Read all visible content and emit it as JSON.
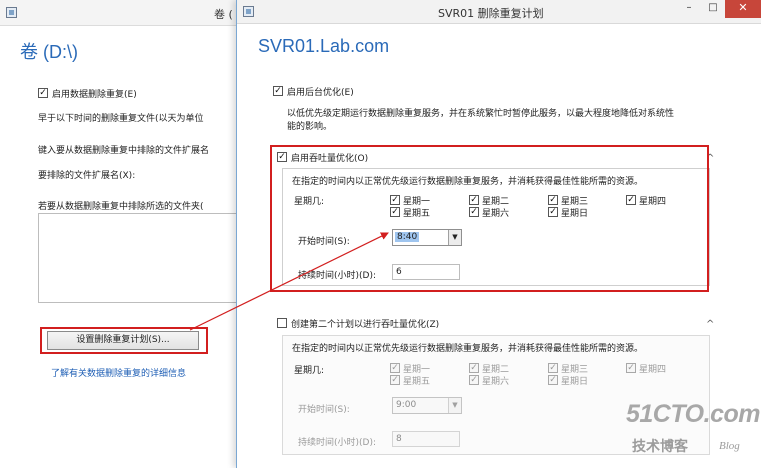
{
  "back_window": {
    "title": "卷 (",
    "heading": "卷 (D:\\)",
    "enable_dedup": {
      "label": "启用数据删除重复(E)",
      "checked": true
    },
    "older_than_text": "早于以下时间的删除重复文件(以天为单位",
    "exclude_ext_text": "键入要从数据删除重复中排除的文件扩展名",
    "ext_label": "要排除的文件扩展名(X):",
    "exclude_folders_text": "若要从数据删除重复中排除所选的文件夹(",
    "schedule_button": "设置删除重复计划(S)...",
    "learn_more_link": "了解有关数据删除重复的详细信息"
  },
  "dialog": {
    "title": "SVR01 删除重复计划",
    "heading": "SVR01.Lab.com",
    "window_controls": {
      "minimize": "–",
      "maximize": "□",
      "close": "✕"
    },
    "background_opt": {
      "label": "启用后台优化(E)",
      "checked": true,
      "description_line1": "以低优先级定期运行数据删除重复服务，并在系统繁忙时暂停此服务，以最大程度地降低对系统性",
      "description_line2": "能的影响。"
    },
    "throughput_opt": {
      "label": "启用吞吐量优化(O)",
      "checked": true,
      "description": "在指定的时间内以正常优先级运行数据删除重复服务，并消耗获得最佳性能所需的资源。",
      "weekday_label": "星期几:",
      "days": [
        {
          "label": "星期一",
          "checked": true
        },
        {
          "label": "星期二",
          "checked": true
        },
        {
          "label": "星期三",
          "checked": true
        },
        {
          "label": "星期四",
          "checked": true
        },
        {
          "label": "星期五",
          "checked": true
        },
        {
          "label": "星期六",
          "checked": true
        },
        {
          "label": "星期日",
          "checked": true
        }
      ],
      "start_time_label": "开始时间(S):",
      "start_time": "8:40",
      "duration_label": "持续时间(小时)(D):",
      "duration": "6"
    },
    "second_schedule": {
      "label": "创建第二个计划以进行吞吐量优化(Z)",
      "checked": false,
      "description": "在指定的时间内以正常优先级运行数据删除重复服务，并消耗获得最佳性能所需的资源。",
      "weekday_label": "星期几:",
      "days": [
        {
          "label": "星期一",
          "checked": true
        },
        {
          "label": "星期二",
          "checked": true
        },
        {
          "label": "星期三",
          "checked": true
        },
        {
          "label": "星期四",
          "checked": true
        },
        {
          "label": "星期五",
          "checked": true
        },
        {
          "label": "星期六",
          "checked": true
        },
        {
          "label": "星期日",
          "checked": true
        }
      ],
      "start_time_label": "开始时间(S):",
      "start_time": "9:00",
      "duration_label": "持续时间(小时)(D):",
      "duration": "8"
    },
    "collapse_icon": "^"
  },
  "watermark": {
    "main": "51CTO.com",
    "sub": "技术博客",
    "blog": "Blog"
  },
  "colors": {
    "accent": "#2a6ab8",
    "annotation": "#d21f1f",
    "link": "#1f5fb5"
  }
}
